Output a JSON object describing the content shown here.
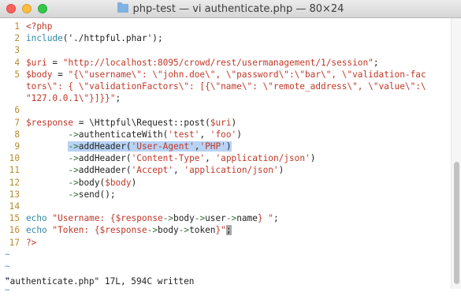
{
  "window": {
    "title": "php-test — vi authenticate.php — 80×24",
    "folder_icon": "folder-icon"
  },
  "editor": {
    "lines": [
      {
        "num": "1",
        "segments": [
          {
            "text": "<?php",
            "cls": "st"
          }
        ]
      },
      {
        "num": "2",
        "segments": [
          {
            "text": "include",
            "cls": "kw"
          },
          {
            "text": "('./httpful.phar');",
            "cls": ""
          }
        ]
      },
      {
        "num": "3",
        "segments": []
      },
      {
        "num": "4",
        "segments": [
          {
            "text": "$uri",
            "cls": "va"
          },
          {
            "text": " = ",
            "cls": ""
          },
          {
            "text": "\"http://localhost:8095/crowd/rest/usermanagement/1/session\"",
            "cls": "st"
          },
          {
            "text": ";",
            "cls": ""
          }
        ]
      },
      {
        "num": "5",
        "segments": [
          {
            "text": "$body",
            "cls": "va"
          },
          {
            "text": " = ",
            "cls": ""
          },
          {
            "text": "\"{\\\"username\\\": \\\"john.doe\\\", \\\"password\\\":\\\"bar\\\", \\\"validation-fac",
            "cls": "st"
          }
        ]
      },
      {
        "num": "",
        "segments": [
          {
            "text": "tors\\\": { \\\"validationFactors\\\": [{\\\"name\\\": \\\"remote_address\\\", \\\"value\\\":\\",
            "cls": "st"
          }
        ]
      },
      {
        "num": "",
        "segments": [
          {
            "text": "\"127.0.0.1\\\"}]}}\"",
            "cls": "st"
          },
          {
            "text": ";",
            "cls": ""
          }
        ]
      },
      {
        "num": "6",
        "segments": []
      },
      {
        "num": "7",
        "segments": [
          {
            "text": "$response",
            "cls": "va"
          },
          {
            "text": " = \\Httpful\\Request::post(",
            "cls": ""
          },
          {
            "text": "$uri",
            "cls": "va"
          },
          {
            "text": ")",
            "cls": ""
          }
        ]
      },
      {
        "num": "8",
        "segments": [
          {
            "text": "        ",
            "cls": ""
          },
          {
            "text": "->",
            "cls": "ar"
          },
          {
            "text": "authenticateWith(",
            "cls": ""
          },
          {
            "text": "'test'",
            "cls": "st"
          },
          {
            "text": ", ",
            "cls": ""
          },
          {
            "text": "'foo'",
            "cls": "st"
          },
          {
            "text": ")",
            "cls": ""
          }
        ]
      },
      {
        "num": "9",
        "segments": [
          {
            "text": "        ",
            "cls": ""
          },
          {
            "text": "->",
            "cls": "ar sel"
          },
          {
            "text": "addHeader(",
            "cls": "sel"
          },
          {
            "text": "'User-Agent'",
            "cls": "st sel"
          },
          {
            "text": ",",
            "cls": "sel"
          },
          {
            "text": "'PHP'",
            "cls": "st sel"
          },
          {
            "text": ")",
            "cls": "sel"
          }
        ]
      },
      {
        "num": "10",
        "segments": [
          {
            "text": "        ",
            "cls": ""
          },
          {
            "text": "->",
            "cls": "ar"
          },
          {
            "text": "addHeader(",
            "cls": ""
          },
          {
            "text": "'Content-Type'",
            "cls": "st"
          },
          {
            "text": ", ",
            "cls": ""
          },
          {
            "text": "'application/json'",
            "cls": "st"
          },
          {
            "text": ")",
            "cls": ""
          }
        ]
      },
      {
        "num": "11",
        "segments": [
          {
            "text": "        ",
            "cls": ""
          },
          {
            "text": "->",
            "cls": "ar"
          },
          {
            "text": "addHeader(",
            "cls": ""
          },
          {
            "text": "'Accept'",
            "cls": "st"
          },
          {
            "text": ", ",
            "cls": ""
          },
          {
            "text": "'application/json'",
            "cls": "st"
          },
          {
            "text": ")",
            "cls": ""
          }
        ]
      },
      {
        "num": "12",
        "segments": [
          {
            "text": "        ",
            "cls": ""
          },
          {
            "text": "->",
            "cls": "ar"
          },
          {
            "text": "body(",
            "cls": ""
          },
          {
            "text": "$body",
            "cls": "va"
          },
          {
            "text": ")",
            "cls": ""
          }
        ]
      },
      {
        "num": "13",
        "segments": [
          {
            "text": "        ",
            "cls": ""
          },
          {
            "text": "->",
            "cls": "ar"
          },
          {
            "text": "send();",
            "cls": ""
          }
        ]
      },
      {
        "num": "14",
        "segments": []
      },
      {
        "num": "15",
        "segments": [
          {
            "text": "echo",
            "cls": "kw"
          },
          {
            "text": " ",
            "cls": ""
          },
          {
            "text": "\"Username: {",
            "cls": "st"
          },
          {
            "text": "$response",
            "cls": "va"
          },
          {
            "text": "->",
            "cls": "ar"
          },
          {
            "text": "body",
            "cls": ""
          },
          {
            "text": "->",
            "cls": "ar"
          },
          {
            "text": "user",
            "cls": ""
          },
          {
            "text": "->",
            "cls": "ar"
          },
          {
            "text": "name",
            "cls": ""
          },
          {
            "text": "} \"",
            "cls": "st"
          },
          {
            "text": ";",
            "cls": ""
          }
        ]
      },
      {
        "num": "16",
        "segments": [
          {
            "text": "echo",
            "cls": "kw"
          },
          {
            "text": " ",
            "cls": ""
          },
          {
            "text": "\"Token: {",
            "cls": "st"
          },
          {
            "text": "$response",
            "cls": "va"
          },
          {
            "text": "->",
            "cls": "ar"
          },
          {
            "text": "body",
            "cls": ""
          },
          {
            "text": "->",
            "cls": "ar"
          },
          {
            "text": "token",
            "cls": ""
          },
          {
            "text": "}\"",
            "cls": "st"
          },
          {
            "text": ";",
            "cls": "cursor"
          }
        ]
      },
      {
        "num": "17",
        "segments": [
          {
            "text": "?>",
            "cls": "st"
          }
        ]
      }
    ],
    "tildes": [
      "~",
      "~",
      "~",
      "~"
    ]
  },
  "status": {
    "message": "\"authenticate.php\" 17L, 594C written"
  }
}
